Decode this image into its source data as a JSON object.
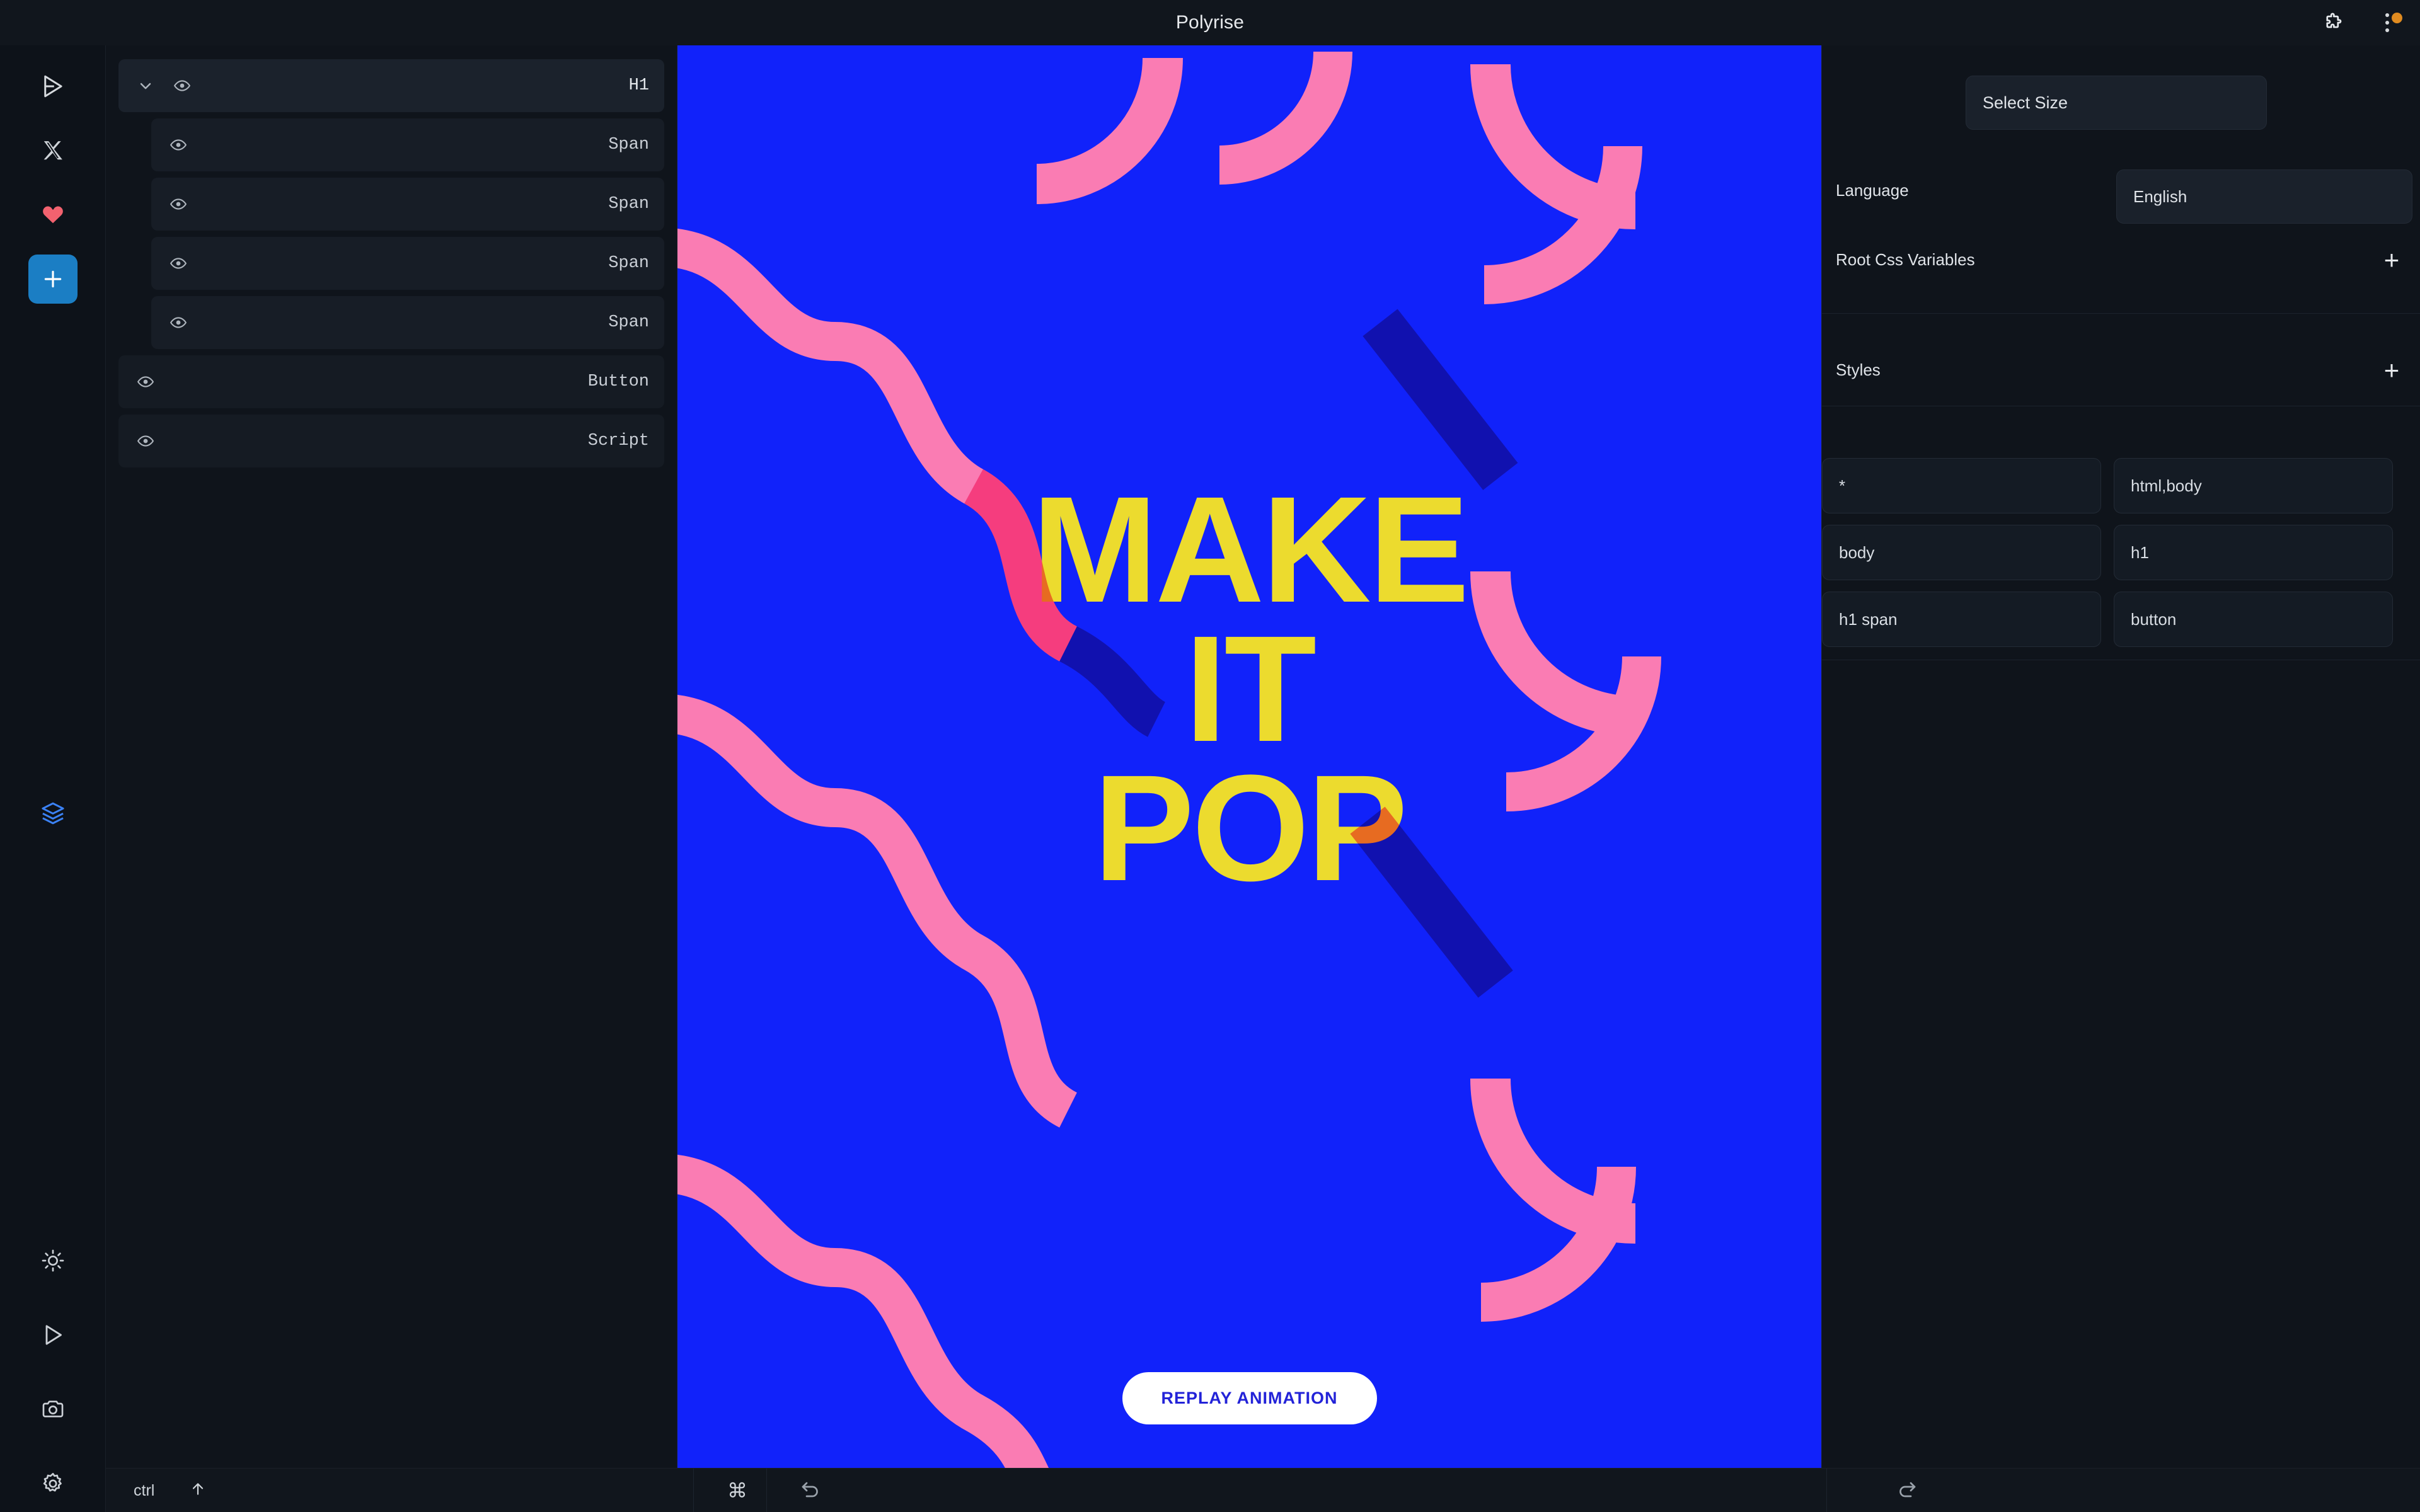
{
  "app": {
    "title": "Polyrise",
    "accent_blue": "#1b7ec4",
    "canvas_blue": "#1122fa",
    "canvas_pink": "#fa7cb3",
    "canvas_yellow": "#ecdb2e",
    "badge_orange": "#e08b20",
    "heart_red": "#f2626f"
  },
  "topbar": {
    "title": "Polyrise",
    "extensions_icon": "puzzle-piece-icon",
    "overflow_icon": "three-dots-vertical-icon"
  },
  "rail": {
    "top_items": [
      {
        "name": "send-icon",
        "label": "Send"
      },
      {
        "name": "x-twitter-icon",
        "label": "X"
      },
      {
        "name": "heart-icon",
        "label": "Favorites"
      },
      {
        "name": "plus-icon",
        "label": "Add",
        "active": true
      }
    ],
    "mid_items": [
      {
        "name": "layers-icon",
        "label": "Layers",
        "active": true
      }
    ],
    "bottom_items": [
      {
        "name": "brightness-icon",
        "label": "Theme"
      },
      {
        "name": "play-icon",
        "label": "Preview"
      },
      {
        "name": "camera-icon",
        "label": "Screenshot"
      },
      {
        "name": "gear-icon",
        "label": "Settings"
      }
    ]
  },
  "layers": {
    "items": [
      {
        "tag": "H1",
        "level": 0,
        "expandable": true,
        "expanded": true
      },
      {
        "tag": "Span",
        "level": 1,
        "expandable": false,
        "expanded": false
      },
      {
        "tag": "Span",
        "level": 1,
        "expandable": false,
        "expanded": false
      },
      {
        "tag": "Span",
        "level": 1,
        "expandable": false,
        "expanded": false
      },
      {
        "tag": "Span",
        "level": 1,
        "expandable": false,
        "expanded": false
      },
      {
        "tag": "Button",
        "level": 0,
        "expandable": false,
        "expanded": false
      },
      {
        "tag": "Script",
        "level": 0,
        "expandable": false,
        "expanded": false
      }
    ]
  },
  "canvas": {
    "headline_line1": "MAKE",
    "headline_line2": "IT",
    "headline_line3": "POP",
    "replay_button": "REPLAY ANIMATION"
  },
  "right_panel": {
    "select_size_label": "Select Size",
    "language_label": "Language",
    "language_value": "English",
    "root_css_variables_label": "Root Css Variables",
    "root_css_add": "+",
    "styles_label": "Styles",
    "styles_add": "+",
    "style_chips": [
      "*",
      "html,body",
      "body",
      "h1",
      "h1 span",
      "button"
    ]
  },
  "bottombar": {
    "modifier_ctrl": "ctrl",
    "shift_icon": "arrow-up-icon",
    "command_symbol": "⌘",
    "undo_icon": "undo-arrow-icon",
    "redo_icon": "redo-arrow-icon"
  }
}
